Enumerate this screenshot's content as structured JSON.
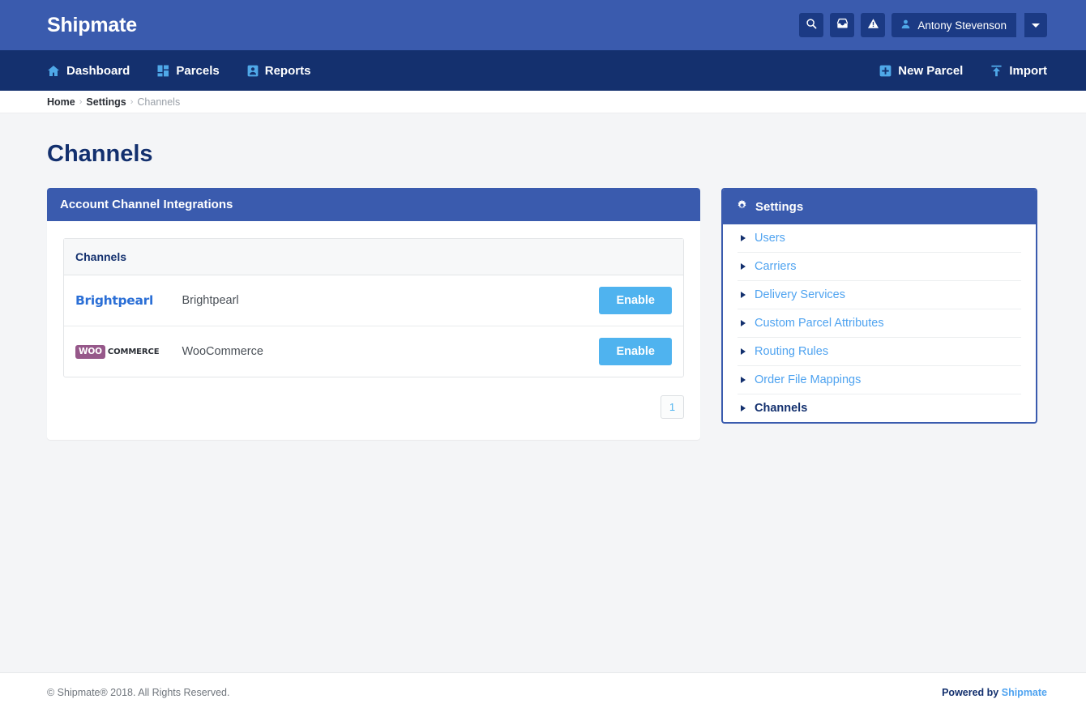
{
  "topbar": {
    "brand": "Shipmate",
    "icons": [
      {
        "name": "search-icon",
        "label": "Search"
      },
      {
        "name": "inbox-icon",
        "label": "Inbox"
      },
      {
        "name": "alert-icon",
        "label": "Alerts"
      }
    ],
    "user": {
      "name": "Antony Stevenson",
      "icon": "user-icon",
      "caret": "chevron-down-icon"
    }
  },
  "nav": {
    "left": [
      {
        "label": "Dashboard",
        "icon": "home-icon"
      },
      {
        "label": "Parcels",
        "icon": "grid-icon"
      },
      {
        "label": "Reports",
        "icon": "id-card-icon"
      }
    ],
    "right": [
      {
        "label": "New Parcel",
        "icon": "plus-square-icon"
      },
      {
        "label": "Import",
        "icon": "upload-icon"
      }
    ]
  },
  "breadcrumb": {
    "items": [
      "Home",
      "Settings",
      "Channels"
    ],
    "separator": "›"
  },
  "page": {
    "title": "Channels"
  },
  "integrations_panel": {
    "title": "Account Channel Integrations",
    "table": {
      "columns": [
        "Channels"
      ],
      "rows": [
        {
          "logo": "brightpearl-logo",
          "logo_text": "Brightpearl",
          "name": "Brightpearl",
          "action": "Enable"
        },
        {
          "logo": "woocommerce-logo",
          "logo_badge": "WOO",
          "logo_text": "COMMERCE",
          "name": "WooCommerce",
          "action": "Enable"
        }
      ]
    },
    "pagination": {
      "pages": [
        "1"
      ],
      "current": "1"
    }
  },
  "settings_panel": {
    "title": "Settings",
    "icon": "gear-icon",
    "items": [
      {
        "label": "Users",
        "active": false
      },
      {
        "label": "Carriers",
        "active": false
      },
      {
        "label": "Delivery Services",
        "active": false
      },
      {
        "label": "Custom Parcel Attributes",
        "active": false
      },
      {
        "label": "Routing Rules",
        "active": false
      },
      {
        "label": "Order File Mappings",
        "active": false
      },
      {
        "label": "Channels",
        "active": true
      }
    ]
  },
  "footer": {
    "copyright": "© Shipmate® 2018. All Rights Reserved.",
    "powered_prefix": "Powered by ",
    "powered_link": "Shipmate"
  },
  "colors": {
    "topbar": "#3a5bae",
    "navbar": "#14306e",
    "accent_blue": "#4fb3ef",
    "link_blue": "#4fa3f0",
    "dark_navy": "#13306e",
    "page_bg": "#f4f5f7",
    "woo_purple": "#96588a",
    "brightpearl_blue": "#2b6fd6"
  }
}
